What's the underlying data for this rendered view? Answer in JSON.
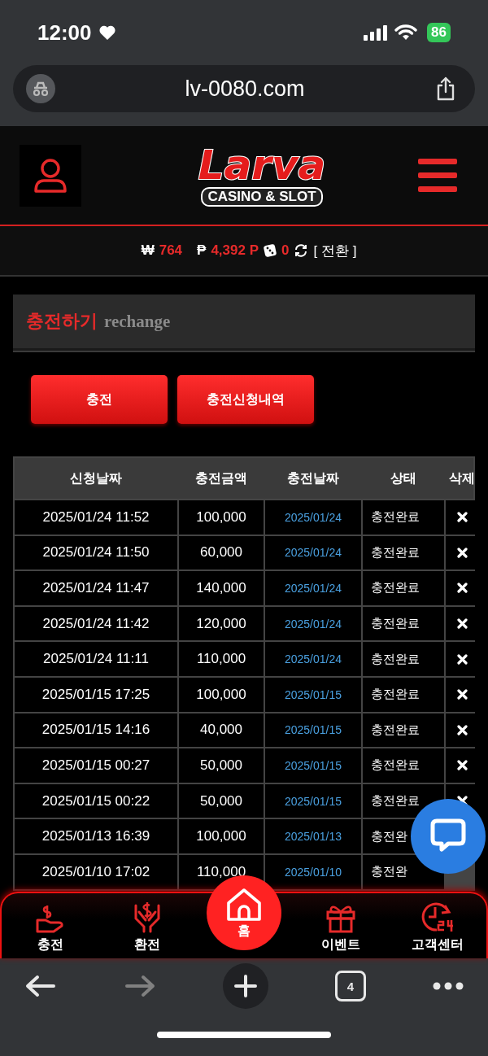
{
  "status_bar": {
    "time": "12:00",
    "battery": "86"
  },
  "browser": {
    "url": "lv-0080.com",
    "tab_count": "4"
  },
  "logo": {
    "name": "Larva",
    "tagline": "CASINO & SLOT"
  },
  "balance": [
    {
      "kind": "won",
      "symbol": "₩",
      "value": "764"
    },
    {
      "kind": "point",
      "symbol": "₱",
      "value": "4,392 P"
    },
    {
      "kind": "dice",
      "value": "0"
    }
  ],
  "exchange_link": "[ 전환 ]",
  "section": {
    "title": "충전하기",
    "subtitle": "rechange"
  },
  "buttons": [
    "충전",
    "충전신청내역"
  ],
  "table": {
    "columns": [
      "신청날짜",
      "충전금액",
      "충전날짜",
      "상태",
      "삭제"
    ],
    "rows": [
      {
        "request_date": "2025/01/24 11:52",
        "amount": "100,000",
        "charge_date": "2025/01/24",
        "status": "충전완료"
      },
      {
        "request_date": "2025/01/24 11:50",
        "amount": "60,000",
        "charge_date": "2025/01/24",
        "status": "충전완료"
      },
      {
        "request_date": "2025/01/24 11:47",
        "amount": "140,000",
        "charge_date": "2025/01/24",
        "status": "충전완료"
      },
      {
        "request_date": "2025/01/24 11:42",
        "amount": "120,000",
        "charge_date": "2025/01/24",
        "status": "충전완료"
      },
      {
        "request_date": "2025/01/24 11:11",
        "amount": "110,000",
        "charge_date": "2025/01/24",
        "status": "충전완료"
      },
      {
        "request_date": "2025/01/15 17:25",
        "amount": "100,000",
        "charge_date": "2025/01/15",
        "status": "충전완료"
      },
      {
        "request_date": "2025/01/15 14:16",
        "amount": "40,000",
        "charge_date": "2025/01/15",
        "status": "충전완료"
      },
      {
        "request_date": "2025/01/15 00:27",
        "amount": "50,000",
        "charge_date": "2025/01/15",
        "status": "충전완료"
      },
      {
        "request_date": "2025/01/15 00:22",
        "amount": "50,000",
        "charge_date": "2025/01/15",
        "status": "충전완료"
      },
      {
        "request_date": "2025/01/13 16:39",
        "amount": "100,000",
        "charge_date": "2025/01/13",
        "status": "충전완",
        "delete_visible": false
      },
      {
        "request_date": "2025/01/10 17:02",
        "amount": "110,000",
        "charge_date": "2025/01/10",
        "status": "충전완",
        "delete_visible": false
      }
    ]
  },
  "bottom_nav": [
    {
      "kind": "charge",
      "label": "충전",
      "selected": false
    },
    {
      "kind": "exchange",
      "label": "환전",
      "selected": false
    },
    {
      "kind": "home",
      "label": "홈",
      "selected": true
    },
    {
      "kind": "event",
      "label": "이벤트",
      "selected": false
    },
    {
      "kind": "support",
      "label": "고객센터",
      "selected": false
    }
  ]
}
